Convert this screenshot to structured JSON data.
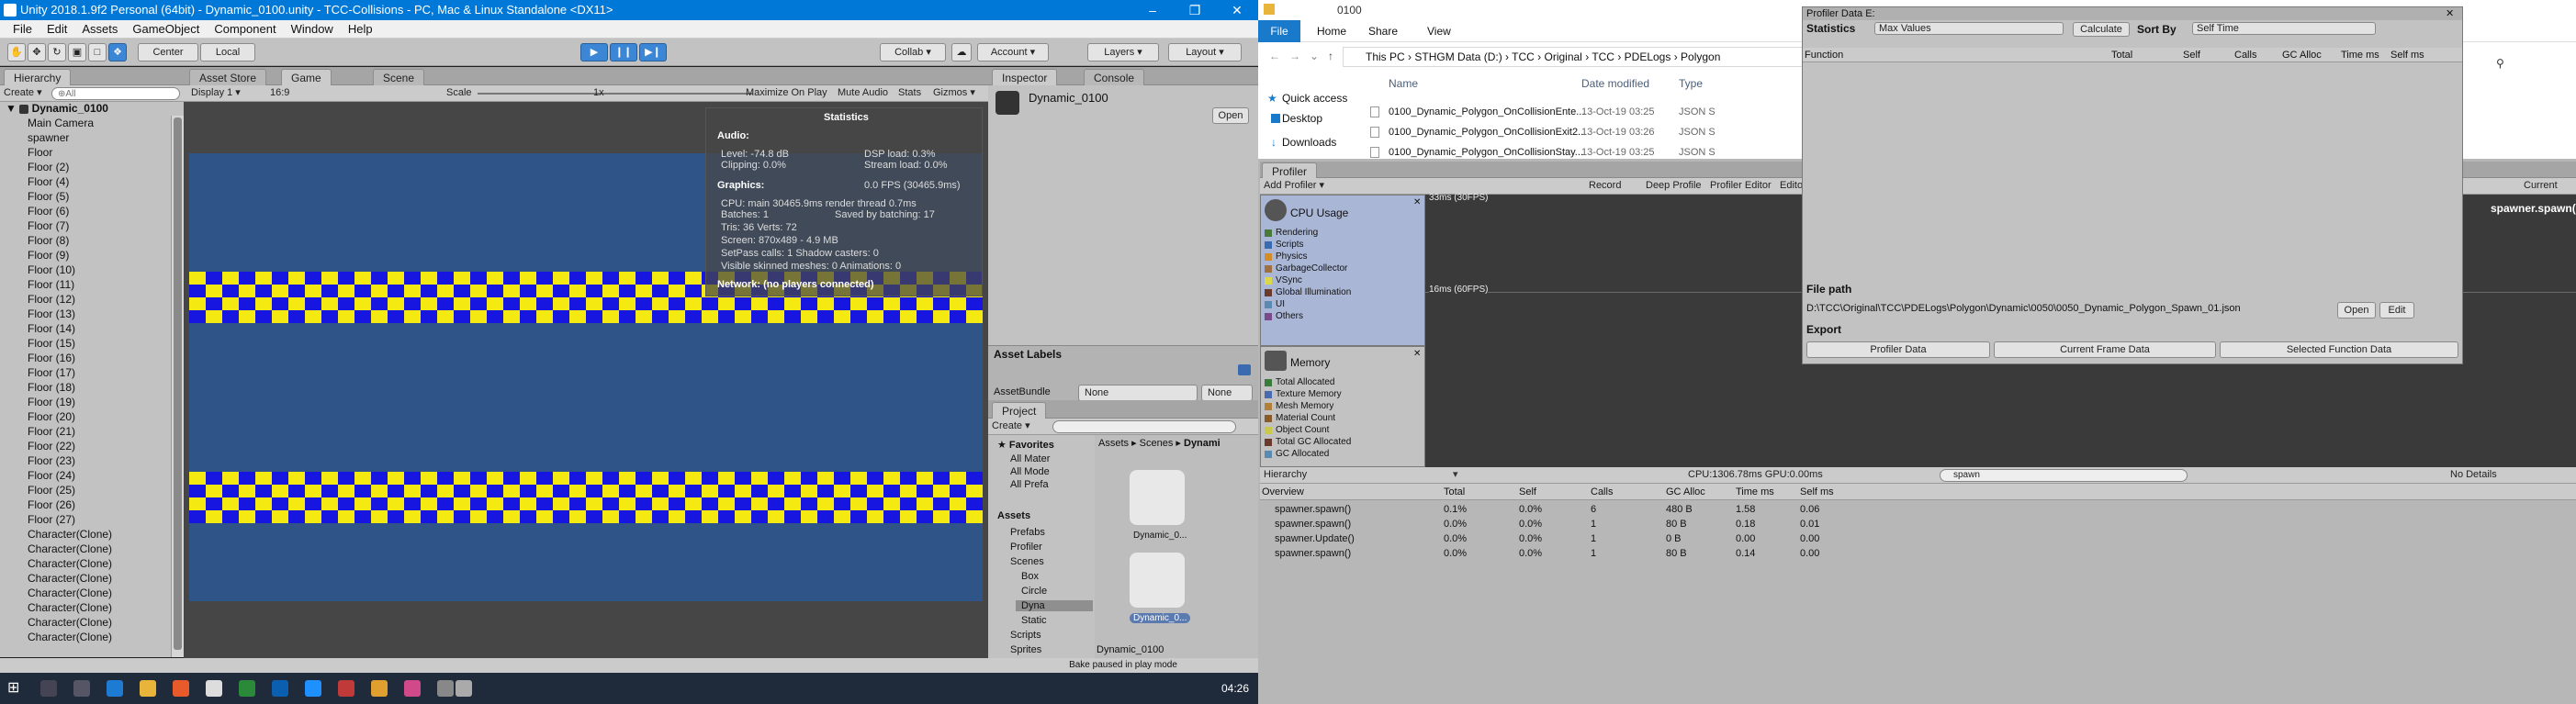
{
  "unity": {
    "title": "Unity 2018.1.9f2 Personal (64bit) - Dynamic_0100.unity - TCC-Collisions - PC, Mac & Linux Standalone <DX11>",
    "menu": [
      "File",
      "Edit",
      "Assets",
      "GameObject",
      "Component",
      "Window",
      "Help"
    ],
    "toolbar": {
      "center": "Center",
      "local": "Local",
      "collab": "Collab ▾",
      "account": "Account ▾",
      "layers": "Layers ▾",
      "layout": "Layout ▾"
    },
    "hierarchy": {
      "tab": "Hierarchy",
      "create": "Create ▾",
      "search_placeholder": "⊕All",
      "scene": "Dynamic_0100",
      "items": [
        "Main Camera",
        "spawner",
        "Floor",
        "Floor (2)",
        "Floor (4)",
        "Floor (5)",
        "Floor (6)",
        "Floor (7)",
        "Floor (8)",
        "Floor (9)",
        "Floor (10)",
        "Floor (11)",
        "Floor (12)",
        "Floor (13)",
        "Floor (14)",
        "Floor (15)",
        "Floor (16)",
        "Floor (17)",
        "Floor (18)",
        "Floor (19)",
        "Floor (20)",
        "Floor (21)",
        "Floor (22)",
        "Floor (23)",
        "Floor (24)",
        "Floor (25)",
        "Floor (26)",
        "Floor (27)",
        "Character(Clone)",
        "Character(Clone)",
        "Character(Clone)",
        "Character(Clone)",
        "Character(Clone)",
        "Character(Clone)",
        "Character(Clone)",
        "Character(Clone)"
      ]
    },
    "game": {
      "tabs": [
        "Asset Store",
        "Game",
        "Scene"
      ],
      "display": "Display 1 ▾",
      "aspect": "16:9",
      "scale_label": "Scale",
      "scale_value": "1x",
      "maximize": "Maximize On Play",
      "mute": "Mute Audio",
      "stats": "Stats",
      "gizmos": "Gizmos ▾",
      "stripe_colors": [
        "#1616e0",
        "#f4ea12"
      ],
      "bg_color": "#2f5488"
    },
    "stats": {
      "title": "Statistics",
      "audio_h": "Audio:",
      "level": "Level: -74.8 dB",
      "clipping": "Clipping: 0.0%",
      "dsp": "DSP load: 0.3%",
      "stream": "Stream load: 0.0%",
      "graphics_h": "Graphics:",
      "fps": "0.0 FPS (30465.9ms)",
      "cpu": "CPU: main 30465.9ms  render thread 0.7ms",
      "batches": "Batches: 1",
      "saved": "Saved by batching: 17",
      "tris": "Tris: 36   Verts: 72",
      "screen": "Screen: 870x489 - 4.9 MB",
      "setpass": "SetPass calls: 1    Shadow casters: 0",
      "skinned": "Visible skinned meshes: 0  Animations: 0",
      "network": "Network: (no players connected)"
    },
    "inspector": {
      "tabs": [
        "Inspector",
        "Console"
      ],
      "object": "Dynamic_0100",
      "open": "Open",
      "asset_labels": "Asset Labels",
      "asset_bundle": "AssetBundle",
      "none1": "None",
      "none2": "None"
    },
    "project": {
      "tab": "Project",
      "create": "Create ▾",
      "favorites": "Favorites",
      "fav_items": [
        "All Mater",
        "All Mode",
        "All Prefa"
      ],
      "assets": "Assets",
      "tree": [
        "Prefabs",
        "Profiler",
        "Scenes",
        "Box",
        "Circle",
        "Dyna",
        "Static",
        "Scripts",
        "Sprites"
      ],
      "breadcrumb": [
        "Assets",
        "Scenes",
        "Dynami"
      ],
      "files": [
        "Dynamic_0...",
        "Dynamic_0..."
      ],
      "selected": "Dynamic_0100",
      "status": "Bake paused in play mode"
    },
    "taskbar": {
      "time": "04:26"
    }
  },
  "explorer": {
    "title": "0100",
    "ribbon": [
      "File",
      "Home",
      "Share",
      "View"
    ],
    "path": [
      "This PC",
      "STHGM Data (D:)",
      "TCC",
      "Original",
      "TCC",
      "PDELogs",
      "Polygon"
    ],
    "nav": [
      "Quick access",
      "Desktop",
      "Downloads"
    ],
    "columns": [
      "Name",
      "Date modified",
      "Type"
    ],
    "files": [
      {
        "name": "0100_Dynamic_Polygon_OnCollisionEnte...",
        "date": "13-Oct-19 03:25",
        "type": "JSON S"
      },
      {
        "name": "0100_Dynamic_Polygon_OnCollisionExit2...",
        "date": "13-Oct-19 03:26",
        "type": "JSON S"
      },
      {
        "name": "0100_Dynamic_Polygon_OnCollisionStay...",
        "date": "13-Oct-19 03:25",
        "type": "JSON S"
      }
    ]
  },
  "profiler": {
    "tab": "Profiler",
    "add": "Add Profiler ▾",
    "toolbar": [
      "Record",
      "Deep Profile",
      "Profiler Editor",
      "Editor"
    ],
    "current": "Current",
    "cpu_title": "CPU Usage",
    "cpu_legend": [
      {
        "label": "Rendering",
        "color": "#4a7a3a"
      },
      {
        "label": "Scripts",
        "color": "#3a6ab0"
      },
      {
        "label": "Physics",
        "color": "#d28c2a"
      },
      {
        "label": "GarbageCollector",
        "color": "#a07040"
      },
      {
        "label": "VSync",
        "color": "#d8d84a"
      },
      {
        "label": "Global Illumination",
        "color": "#6a3a2a"
      },
      {
        "label": "UI",
        "color": "#5a8ab0"
      },
      {
        "label": "Others",
        "color": "#7a4a8a"
      }
    ],
    "fps16": "16ms (60FPS)",
    "fps33": "33ms (30FPS)",
    "spawn_label": "spawner.spawn()",
    "mem_title": "Memory",
    "mem_legend": [
      {
        "label": "Total Allocated",
        "color": "#3a7a3a"
      },
      {
        "label": "Texture Memory",
        "color": "#4a6ab0"
      },
      {
        "label": "Mesh Memory",
        "color": "#b0803a"
      },
      {
        "label": "Material Count",
        "color": "#8a5a2a"
      },
      {
        "label": "Object Count",
        "color": "#c8c84a"
      },
      {
        "label": "Total GC Allocated",
        "color": "#6a3a2a"
      },
      {
        "label": "GC Allocated",
        "color": "#5a8ab0"
      }
    ],
    "hier_mode": "Hierarchy",
    "cpu_summary": "CPU:1306.78ms   GPU:0.00ms",
    "search": "spawn",
    "details": "No Details",
    "table_cols": [
      "Overview",
      "Total",
      "Self",
      "Calls",
      "GC Alloc",
      "Time ms",
      "Self ms"
    ],
    "rows": [
      [
        "spawner.spawn()",
        "0.1%",
        "0.0%",
        "6",
        "480 B",
        "1.58",
        "0.06"
      ],
      [
        "spawner.spawn()",
        "0.0%",
        "0.0%",
        "1",
        "80 B",
        "0.18",
        "0.01"
      ],
      [
        "spawner.Update()",
        "0.0%",
        "0.0%",
        "1",
        "0 B",
        "0.00",
        "0.00"
      ],
      [
        "spawner.spawn()",
        "0.0%",
        "0.0%",
        "1",
        "80 B",
        "0.14",
        "0.00"
      ]
    ]
  },
  "pdata": {
    "title": "Profiler Data E:",
    "statistics": "Statistics",
    "max_values": "Max Values",
    "calculate": "Calculate",
    "sort_by": "Sort By",
    "sort_value": "Self Time",
    "cols": [
      "Function",
      "Total",
      "Self",
      "Calls",
      "GC Alloc",
      "Time ms",
      "Self ms"
    ],
    "file_path_h": "File path",
    "file_path": "D:\\TCC\\Original\\TCC\\PDELogs\\Polygon\\Dynamic\\0050\\0050_Dynamic_Polygon_Spawn_01.json",
    "open": "Open",
    "edit": "Edit",
    "export_h": "Export",
    "btns": [
      "Profiler Data",
      "Current Frame Data",
      "Selected Function Data"
    ]
  }
}
